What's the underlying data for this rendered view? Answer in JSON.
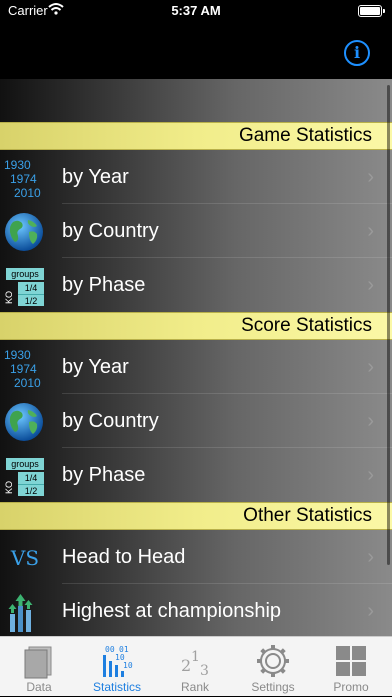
{
  "status_bar": {
    "carrier": "Carrier",
    "time": "5:37 AM"
  },
  "nav": {
    "info_icon": "i"
  },
  "sections": [
    {
      "title": "Game Statistics",
      "rows": [
        {
          "label": "by Year",
          "icon": "year-icon",
          "icon_text": [
            "1930",
            "1974",
            "2010"
          ]
        },
        {
          "label": "by Country",
          "icon": "globe-icon"
        },
        {
          "label": "by Phase",
          "icon": "phase-icon",
          "icon_text": {
            "groups": "groups",
            "ko": "KO",
            "qf": "1/4",
            "sf": "1/2"
          }
        }
      ]
    },
    {
      "title": "Score Statistics",
      "rows": [
        {
          "label": "by Year",
          "icon": "year-icon",
          "icon_text": [
            "1930",
            "1974",
            "2010"
          ]
        },
        {
          "label": "by Country",
          "icon": "globe-icon"
        },
        {
          "label": "by Phase",
          "icon": "phase-icon",
          "icon_text": {
            "groups": "groups",
            "ko": "KO",
            "qf": "1/4",
            "sf": "1/2"
          }
        }
      ]
    },
    {
      "title": "Other Statistics",
      "rows": [
        {
          "label": "Head to Head",
          "icon": "vs-icon",
          "icon_text": "VS"
        },
        {
          "label": "Highest at championship",
          "icon": "bar-arrows-icon"
        }
      ]
    }
  ],
  "chevron": "›",
  "tabs": [
    {
      "label": "Data",
      "icon": "data-icon",
      "active": false
    },
    {
      "label": "Statistics",
      "icon": "statistics-icon",
      "active": true,
      "icon_text": [
        "00",
        "01",
        "10",
        "10"
      ]
    },
    {
      "label": "Rank",
      "icon": "rank-icon",
      "active": false,
      "icon_text": [
        "2",
        "1",
        "3"
      ]
    },
    {
      "label": "Settings",
      "icon": "gear-icon",
      "active": false
    },
    {
      "label": "Promo",
      "icon": "grid-icon",
      "active": false
    }
  ],
  "colors": {
    "accent": "#1e90ff",
    "section_header": "#f1ed8a",
    "tab_active": "#1e7fe0",
    "tab_inactive": "#8a8a8a"
  }
}
